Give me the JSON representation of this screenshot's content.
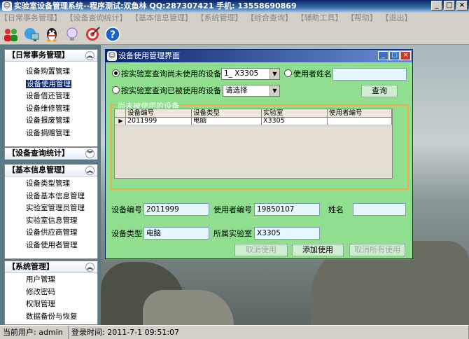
{
  "window": {
    "title": "实验室设备管理系统--程序测试:双鱼林 QQ:287307421 手机: 13558690869",
    "buttons": [
      "_",
      "□",
      "×"
    ]
  },
  "menu": [
    "【日常事务管理】",
    "【设备查询统计】",
    "【基本信息管理】",
    "【系统管理】",
    "【综合查询】",
    "【辅助工具】",
    "【帮助】",
    "【退出】"
  ],
  "toolbar": [
    "users-icon",
    "network-icon",
    "qq-icon",
    "lightbulb-icon",
    "target-icon",
    "help-icon"
  ],
  "sidebar": {
    "daily": {
      "title": "【日常事务管理】",
      "items": [
        "设备购置管理",
        "设备使用管理",
        "设备借还管理",
        "设备维修管理",
        "设备报废管理",
        "设备捐赠管理"
      ],
      "selected": "设备使用管理"
    },
    "query": {
      "title": "【设备查询统计】"
    },
    "basic": {
      "title": "【基本信息管理】",
      "items": [
        "设备类型管理",
        "设备基本信息管理",
        "实验室管理员管理",
        "实验室信息管理",
        "设备供应商管理",
        "设备使用者管理"
      ]
    },
    "system": {
      "title": "【系统管理】",
      "items": [
        "用户管理",
        "修改密码",
        "权限管理",
        "数据备份与恢复"
      ]
    }
  },
  "status": {
    "user": "当前用户: admin",
    "login_time": "登录时间: 2011-7-1 09:51:07"
  },
  "dialog": {
    "title": "设备使用管理界面",
    "radio1_label": "按实验室查询尚未使用的设备",
    "radio1_selected": true,
    "combo1_value": "1_ X3305",
    "radio_user_label": "使用者姓名",
    "user_name_value": "",
    "radio2_label": "按实验室查询已被使用的设备",
    "combo2_value": "请选择",
    "query_button": "查询",
    "group_title": "尚未被使用的设备",
    "grid": {
      "columns": [
        "设备编号",
        "设备类型",
        "实验室",
        "使用者编号"
      ],
      "rows": [
        [
          "2011999",
          "电脑",
          "X3305",
          ""
        ]
      ]
    },
    "fields": {
      "device_no_label": "设备编号",
      "device_no_value": "2011999",
      "user_no_label": "使用者编号",
      "user_no_value": "19850107",
      "name_label": "姓名",
      "name_value": "",
      "device_type_label": "设备类型",
      "device_type_value": "电脑",
      "lab_label": "所属实验室",
      "lab_value": "X3305"
    },
    "buttons": {
      "cancel": "取消使用",
      "add": "添加使用",
      "cancel_all": "取消所有使用"
    }
  }
}
